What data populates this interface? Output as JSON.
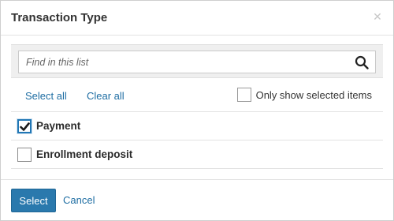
{
  "dialog": {
    "title": "Transaction Type",
    "close_icon": "close-icon"
  },
  "search": {
    "placeholder": "Find in this list",
    "value": "",
    "icon": "search-icon"
  },
  "actions": {
    "select_all": "Select all",
    "clear_all": "Clear all",
    "only_selected_label": "Only show selected items",
    "only_selected_checked": false
  },
  "items": [
    {
      "label": "Payment",
      "checked": true
    },
    {
      "label": "Enrollment deposit",
      "checked": false
    }
  ],
  "footer": {
    "select_label": "Select",
    "cancel_label": "Cancel"
  },
  "colors": {
    "accent": "#2a79ad",
    "link": "#1f6ea3"
  }
}
